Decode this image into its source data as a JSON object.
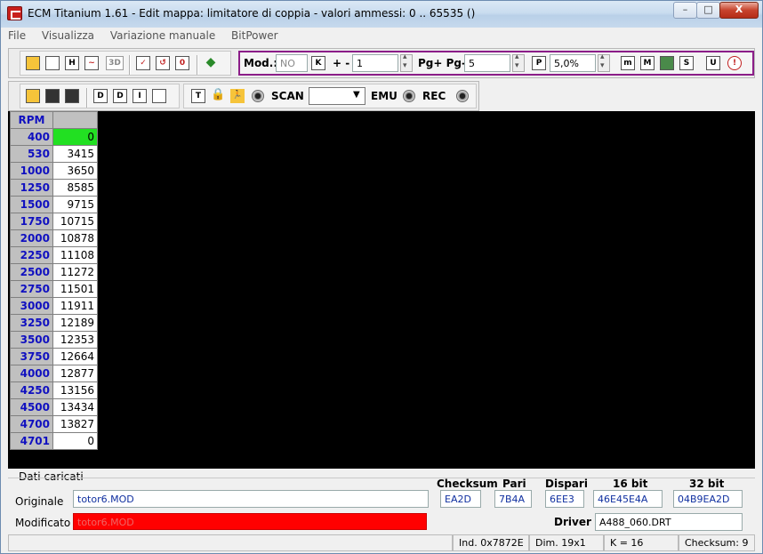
{
  "window": {
    "title": "ECM Titanium 1.61 - Edit mappa: limitatore di coppia - valori ammessi: 0 .. 65535 ()"
  },
  "window_controls": {
    "minimize": "–",
    "maximize": "□",
    "close": "X"
  },
  "menu": [
    "File",
    "Visualizza",
    "Variazione manuale",
    "BitPower"
  ],
  "toolbar1": {
    "icons": [
      "H",
      "3D",
      "0"
    ],
    "mod_label": "Mod.:",
    "mod_value": "NO",
    "k_label": "K",
    "plusminus_label": "+ -",
    "step_value": "1",
    "pg_label": "Pg+ Pg-",
    "pg_value": "5",
    "p_label": "P",
    "percent_value": "5,0%",
    "right_icons": [
      "m",
      "M",
      "S",
      "U"
    ]
  },
  "toolbar2": {
    "icons": [
      "D",
      "D",
      "I",
      "T"
    ],
    "scan_label": "SCAN",
    "scan_select": "",
    "emu_label": "EMU",
    "rec_label": "REC"
  },
  "table": {
    "header": "RPM",
    "rows": [
      {
        "rpm": "400",
        "value": "0"
      },
      {
        "rpm": "530",
        "value": "3415"
      },
      {
        "rpm": "1000",
        "value": "3650"
      },
      {
        "rpm": "1250",
        "value": "8585"
      },
      {
        "rpm": "1500",
        "value": "9715"
      },
      {
        "rpm": "1750",
        "value": "10715"
      },
      {
        "rpm": "2000",
        "value": "10878"
      },
      {
        "rpm": "2250",
        "value": "11108"
      },
      {
        "rpm": "2500",
        "value": "11272"
      },
      {
        "rpm": "2750",
        "value": "11501"
      },
      {
        "rpm": "3000",
        "value": "11911"
      },
      {
        "rpm": "3250",
        "value": "12189"
      },
      {
        "rpm": "3500",
        "value": "12353"
      },
      {
        "rpm": "3750",
        "value": "12664"
      },
      {
        "rpm": "4000",
        "value": "12877"
      },
      {
        "rpm": "4250",
        "value": "13156"
      },
      {
        "rpm": "4500",
        "value": "13434"
      },
      {
        "rpm": "4700",
        "value": "13827"
      },
      {
        "rpm": "4701",
        "value": "0"
      }
    ]
  },
  "loaded": {
    "section_title": "Dati caricati",
    "original_label": "Originale",
    "original_file": "totor6.MOD",
    "modified_label": "Modificato",
    "modified_file": "totor6.MOD",
    "checksum_label": "Checksum",
    "checksum_value": "EA2D",
    "pari_label": "Pari",
    "pari_value": "7B4A",
    "dispari_label": "Dispari",
    "dispari_value": "6EE3",
    "bit16_label": "16 bit",
    "bit16_value": "46E45E4A",
    "bit32_label": "32 bit",
    "bit32_value": "04B9EA2D",
    "driver_label": "Driver",
    "driver_value": "A488_060.DRT"
  },
  "status": {
    "ind": "Ind. 0x7872E",
    "dim": "Dim. 19x1",
    "k": "K = 16",
    "checksum": "Checksum: 9"
  },
  "colors": {
    "accent_green": "#22e022",
    "modified_red": "#ff0000",
    "rpm_blue": "#1010c0",
    "group_border": "#8b1d88"
  }
}
